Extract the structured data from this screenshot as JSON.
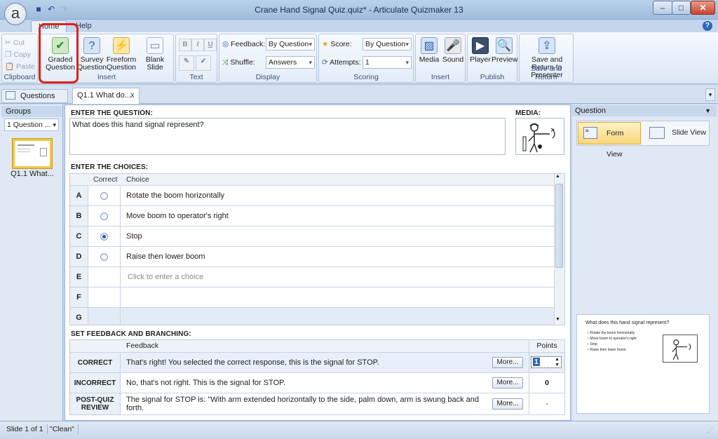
{
  "window": {
    "title": "Crane Hand Signal Quiz.quiz* - Articulate Quizmaker 13",
    "app_button": "a",
    "min": "–",
    "max": "□",
    "close": "✕"
  },
  "ribbon": {
    "tabs": [
      "Home",
      "Help"
    ],
    "clipboard": {
      "cut": "Cut",
      "copy": "Copy",
      "paste": "Paste",
      "label": "Clipboard"
    },
    "insert": {
      "graded": "Graded Question",
      "survey": "Survey Question",
      "freeform": "Freeform Question",
      "blank": "Blank Slide",
      "label": "Insert"
    },
    "text": {
      "bold": "B",
      "italic": "I",
      "underline": "U",
      "label": "Text"
    },
    "display": {
      "feedback_label": "Feedback:",
      "feedback_value": "By Question",
      "shuffle_label": "Shuffle:",
      "shuffle_value": "Answers",
      "label": "Display"
    },
    "scoring": {
      "score_label": "Score:",
      "score_value": "By Question",
      "attempts_label": "Attempts:",
      "attempts_value": "1",
      "label": "Scoring"
    },
    "insert2": {
      "media": "Media",
      "sound": "Sound",
      "label": "Insert"
    },
    "publish": {
      "player": "Player",
      "preview": "Preview",
      "label": "Publish"
    },
    "save": {
      "button": "Save and Return to Presenter",
      "label": "Save and Return"
    }
  },
  "doctabs": {
    "questions": "Questions",
    "current": "Q1.1 What do...",
    "close": "x"
  },
  "left": {
    "groups_header": "Groups",
    "groups_value": "1 Question ...",
    "thumb_label": "Q1.1 What..."
  },
  "question": {
    "header": "ENTER THE QUESTION:",
    "text": "What does this hand signal represent?",
    "media_header": "MEDIA:"
  },
  "choices": {
    "header": "ENTER THE CHOICES:",
    "col_correct": "Correct",
    "col_choice": "Choice",
    "rows": [
      {
        "letter": "A",
        "text": "Rotate the boom horizontally",
        "correct": false
      },
      {
        "letter": "B",
        "text": "Move boom to operator's right",
        "correct": false
      },
      {
        "letter": "C",
        "text": "Stop",
        "correct": true
      },
      {
        "letter": "D",
        "text": "Raise then lower boom",
        "correct": false
      },
      {
        "letter": "E",
        "text": "Click to enter a choice",
        "correct": false
      },
      {
        "letter": "F",
        "text": "",
        "correct": false
      },
      {
        "letter": "G",
        "text": "",
        "correct": false
      }
    ]
  },
  "feedback": {
    "header": "SET FEEDBACK AND BRANCHING:",
    "col_feedback": "Feedback",
    "col_points": "Points",
    "more": "More...",
    "correct_label": "CORRECT",
    "correct_text": "That's right!  You selected the correct response, this is the signal for STOP.",
    "correct_points": "1",
    "incorrect_label": "INCORRECT",
    "incorrect_text": "No, that's not right. This is the signal for STOP.",
    "incorrect_points": "0",
    "post_label": "POST-QUIZ REVIEW",
    "post_text": "The signal for STOP is: \"With arm extended horizontally to the side, palm down, arm is swung back and forth.",
    "post_points": "-"
  },
  "right": {
    "header": "Question",
    "form_view": "Form View",
    "slide_view": "Slide View",
    "preview_title": "What does this hand signal represent?",
    "preview_choices": [
      "Rotate the boom horizontally",
      "Move boom to operator's right",
      "Stop",
      "Raise then lower boom"
    ]
  },
  "status": {
    "slide": "Slide 1 of 1",
    "theme": "\"Clean\""
  }
}
